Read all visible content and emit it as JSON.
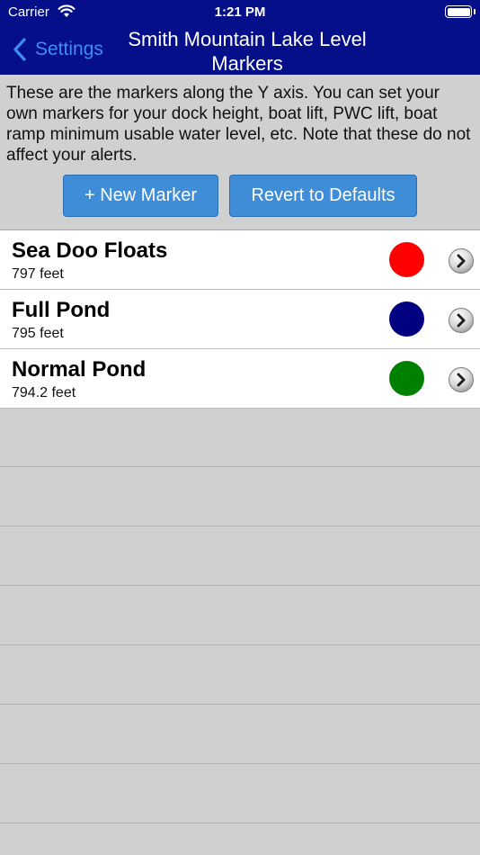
{
  "status_bar": {
    "carrier": "Carrier",
    "time": "1:21 PM"
  },
  "nav": {
    "back_label": "Settings",
    "title": "Smith Mountain Lake Level Markers"
  },
  "intro": {
    "text": "These are the markers along the Y axis.  You can set your own markers for your dock height, boat lift, PWC lift, boat ramp minimum usable water level, etc.  Note that these do not affect your alerts."
  },
  "buttons": {
    "new_marker": "+ New Marker",
    "revert": "Revert to Defaults"
  },
  "markers": [
    {
      "name": "Sea Doo Floats",
      "level": "797 feet",
      "color": "#ff0000"
    },
    {
      "name": "Full Pond",
      "level": "795 feet",
      "color": "#000080"
    },
    {
      "name": "Normal Pond",
      "level": "794.2 feet",
      "color": "#008000"
    }
  ],
  "colors": {
    "nav_bar": "#050f8a",
    "accent_blue": "#3f8cf7",
    "button_blue": "#3f8dd6",
    "background": "#d0d0d0"
  },
  "icons": {
    "back": "chevron-left-icon",
    "disclosure": "chevron-right-icon",
    "wifi": "wifi-icon",
    "battery": "battery-icon"
  }
}
